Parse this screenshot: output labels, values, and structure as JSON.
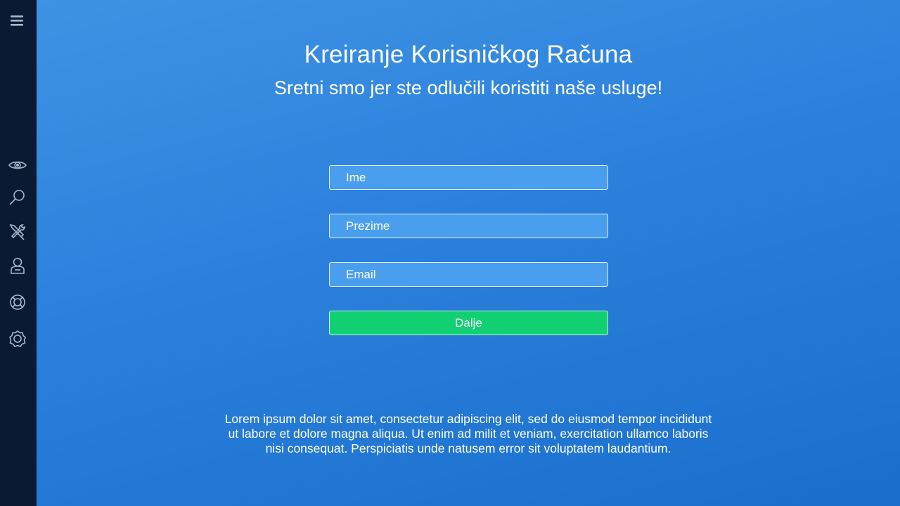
{
  "sidebar": {
    "menu_icon": "hamburger-menu-icon",
    "items": [
      {
        "icon": "eye-icon"
      },
      {
        "icon": "search-icon"
      },
      {
        "icon": "tools-icon"
      },
      {
        "icon": "user-icon"
      },
      {
        "icon": "lifebuoy-icon"
      },
      {
        "icon": "settings-icon"
      }
    ],
    "background": "#0b1a33",
    "icon_color": "#a9b6c8"
  },
  "main": {
    "title": "Kreiranje Korisničkog Računa",
    "subtitle": "Sretni smo jer ste odlučili koristiti naše usluge!",
    "form": {
      "first_name": {
        "placeholder": "Ime",
        "value": ""
      },
      "last_name": {
        "placeholder": "Prezime",
        "value": ""
      },
      "email": {
        "placeholder": "Email",
        "value": ""
      },
      "submit_label": "Dalje"
    },
    "description": "Lorem ipsum dolor sit amet, consectetur adipiscing elit, sed do eiusmod tempor incididunt ut labore et dolore magna aliqua. Ut enim ad  milit et veniam, exercitation ullamco laboris nisi consequat. Perspiciatis unde natusem error sit voluptatem laudantium."
  },
  "colors": {
    "accent": "#10d072",
    "background_top": "#3f93e4",
    "background_bottom": "#1a6fcc",
    "field_fill": "#4a9eee"
  }
}
